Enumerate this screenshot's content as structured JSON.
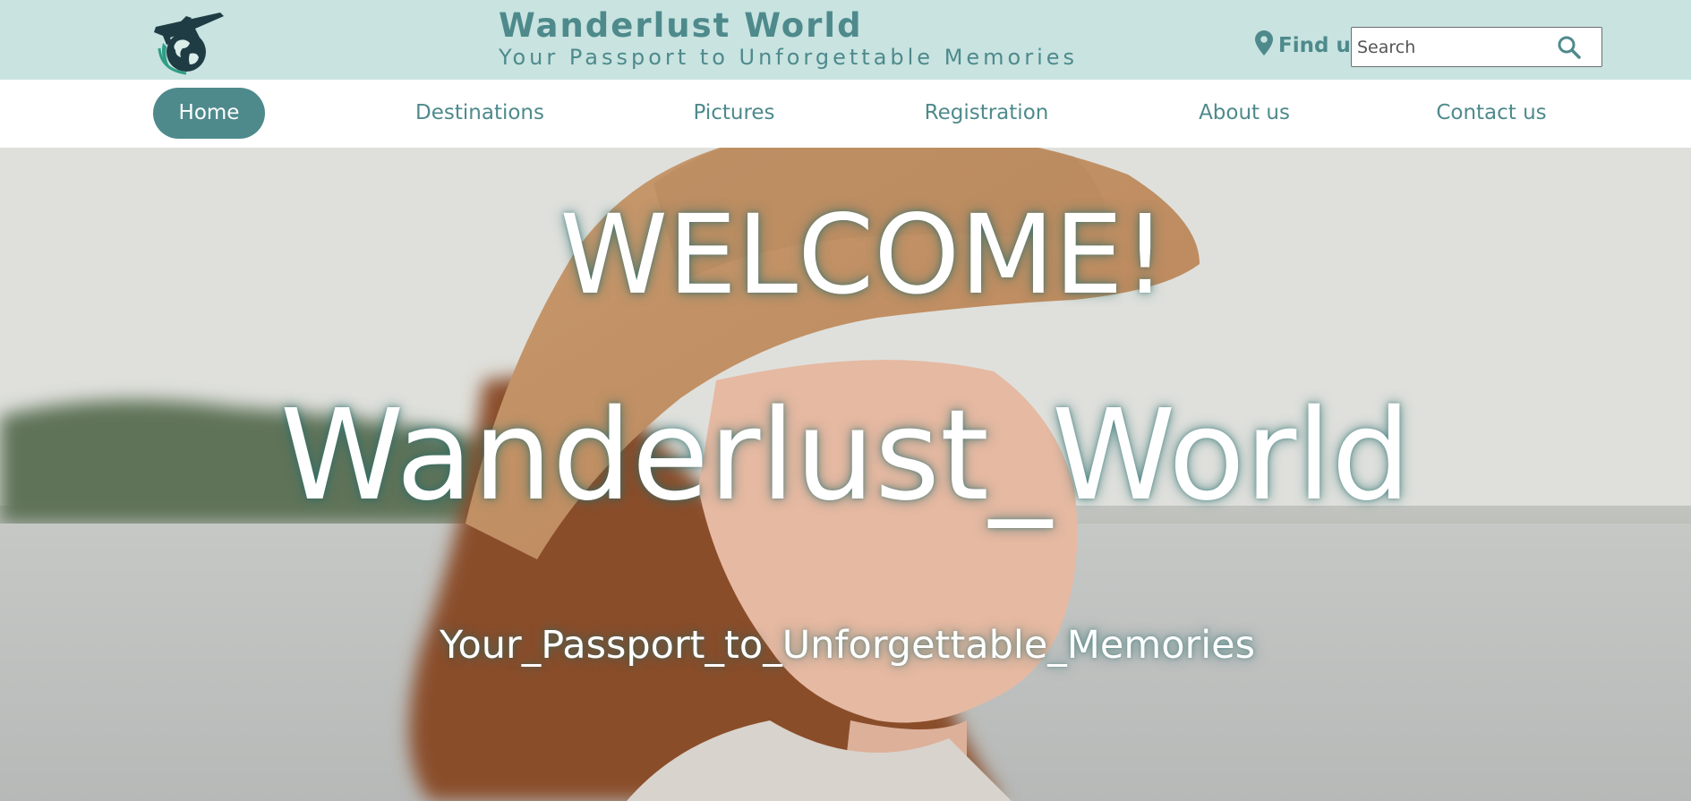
{
  "header": {
    "title": "Wanderlust World",
    "subtitle": "Your Passport to Unforgettable Memories",
    "logo_icon": "airplane-globe-logo-icon",
    "find_us_label": "Find us",
    "find_us_icon": "map-pin-icon",
    "search": {
      "placeholder": "Search",
      "value": "",
      "button_icon": "search-icon"
    }
  },
  "nav": {
    "items": [
      {
        "label": "Home",
        "active": true
      },
      {
        "label": "Destinations",
        "active": false
      },
      {
        "label": "Pictures",
        "active": false
      },
      {
        "label": "Registration",
        "active": false
      },
      {
        "label": "About us",
        "active": false
      },
      {
        "label": "Contact us",
        "active": false
      }
    ]
  },
  "hero": {
    "welcome": "WELCOME!",
    "title": "Wanderlust_World",
    "tagline": "Your_Passport_to_Unforgettable_Memories",
    "image": "woman-in-hat-by-lake-photo"
  },
  "colors": {
    "header_bg": "#c8e3e0",
    "brand": "#4e8a8c",
    "nav_bg": "#ffffff",
    "active_pill": "#4e8a8c"
  }
}
